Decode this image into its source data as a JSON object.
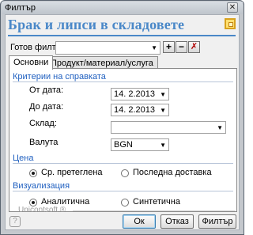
{
  "window": {
    "title": "Филтър",
    "close_glyph": "✕"
  },
  "header": {
    "title": "Брак и липси в складовете",
    "icon": "window-restore-icon"
  },
  "ready_filter": {
    "label": "Готов филтър:",
    "value": "",
    "add_glyph": "+",
    "remove_glyph": "−",
    "delete_glyph": "✗"
  },
  "tabs": [
    {
      "label": "Основни"
    },
    {
      "label": "Продукт/материал/услуга"
    }
  ],
  "criteria": {
    "section_title": "Критерии на справката",
    "from_date": {
      "label": "От дата:",
      "value": "14.  2.2013"
    },
    "to_date": {
      "label": "До дата:",
      "value": "14.  2.2013"
    },
    "warehouse": {
      "label": "Склад:",
      "value": ""
    },
    "currency": {
      "label": "Валута",
      "value": "BGN"
    }
  },
  "price": {
    "section_title": "Цена",
    "options": [
      {
        "label": "Ср. претеглена",
        "selected": true
      },
      {
        "label": "Последна доставка",
        "selected": false
      }
    ]
  },
  "visualization": {
    "section_title": "Визуализация",
    "options": [
      {
        "label": "Аналитична",
        "selected": true
      },
      {
        "label": "Синтетична",
        "selected": false
      }
    ]
  },
  "footer": {
    "brand": "Unicontsoft ®",
    "help_glyph": "?",
    "ok_label": "Ок",
    "cancel_label": "Отказ",
    "filter_label": "Филтър"
  },
  "colors": {
    "accent": "#4a88c8",
    "section": "#2060c0"
  }
}
